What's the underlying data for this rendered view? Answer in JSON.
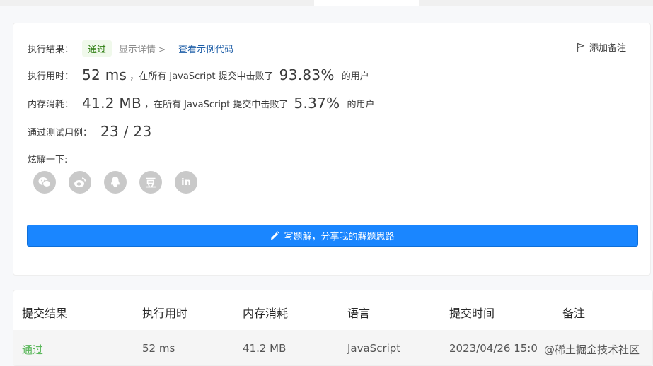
{
  "summary": {
    "result_label": "执行结果：",
    "result_badge": "通过",
    "detail_link": "显示详情",
    "detail_chevron": ">",
    "sample_link": "查看示例代码",
    "add_note": "添加备注"
  },
  "runtime": {
    "label": "执行用时：",
    "value": "52 ms",
    "text_mid": "，在所有 JavaScript 提交中击败了",
    "percent": "93.83%",
    "text_end": "的用户"
  },
  "memory": {
    "label": "内存消耗：",
    "value": "41.2 MB",
    "text_mid": "，在所有 JavaScript 提交中击败了",
    "percent": "5.37%",
    "text_end": "的用户"
  },
  "tests": {
    "label": "通过测试用例：",
    "value": "23 / 23"
  },
  "share": {
    "label": "炫耀一下:",
    "icons": [
      "wechat-icon",
      "weibo-icon",
      "qq-icon",
      "douban-icon",
      "linkedin-icon"
    ],
    "douban_glyph": "豆",
    "linkedin_glyph": "in"
  },
  "write_solution": {
    "label": "写题解，分享我的解题思路"
  },
  "submissions": {
    "headers": [
      "提交结果",
      "执行用时",
      "内存消耗",
      "语言",
      "提交时间",
      "备注"
    ],
    "rows": [
      {
        "result": "通过",
        "runtime": "52 ms",
        "memory": "41.2 MB",
        "language": "JavaScript",
        "time": "2023/04/26 15:0",
        "watermark": "@稀土掘金技术社区"
      }
    ]
  },
  "colors": {
    "accent_blue": "#1a86ff",
    "pass_green": "#5cb85c",
    "link_blue": "#1f5fa8"
  }
}
